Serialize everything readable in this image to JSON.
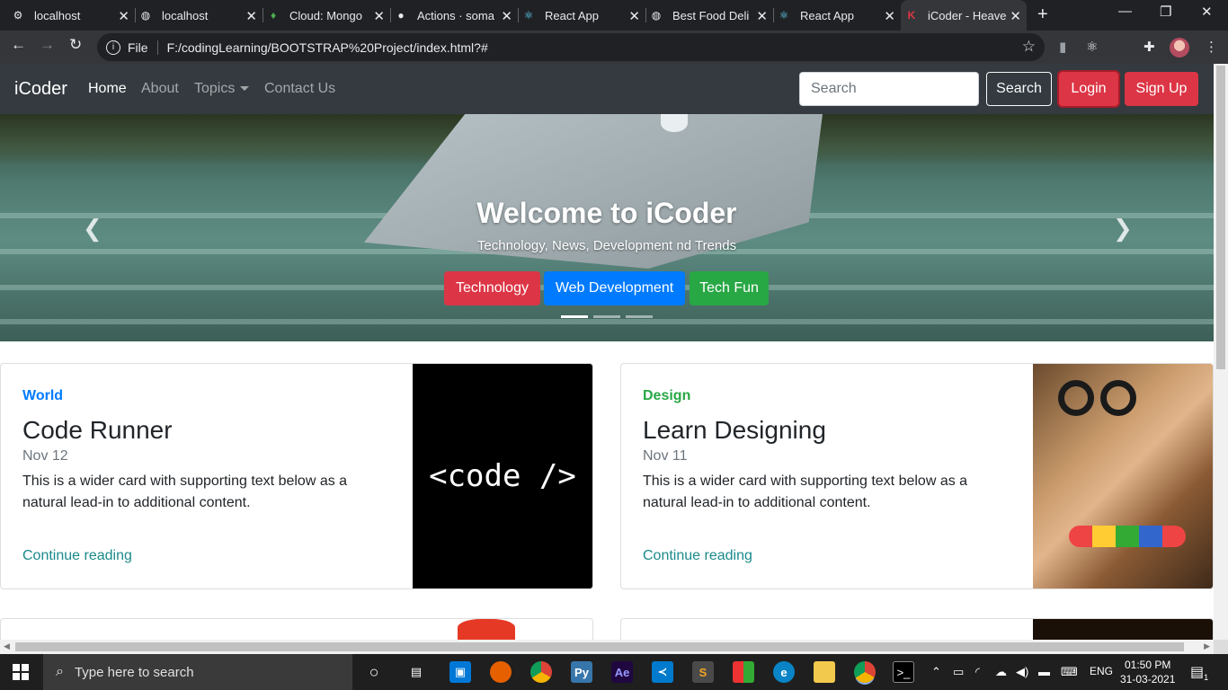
{
  "browser": {
    "tabs": [
      {
        "label": "localhost",
        "icon": "settings-icon",
        "x": 0
      },
      {
        "label": "localhost",
        "icon": "globe-icon"
      },
      {
        "label": "Cloud: Mongo",
        "icon": "leaf-icon"
      },
      {
        "label": "Actions · soma",
        "icon": "github-icon"
      },
      {
        "label": "React App",
        "icon": "react-icon"
      },
      {
        "label": "Best Food Deli",
        "icon": "globe-icon"
      },
      {
        "label": "React App",
        "icon": "react-icon"
      },
      {
        "label": "iCoder - Heave",
        "icon": "icoder-icon",
        "active": true
      }
    ],
    "file_label": "File",
    "url": "F:/codingLearning/BOOTSTRAP%20Project/index.html?#"
  },
  "navbar": {
    "brand": "iCoder",
    "links": [
      "Home",
      "About",
      "Topics",
      "Contact Us"
    ],
    "search_placeholder": "Search",
    "search_button": "Search",
    "login_button": "Login",
    "signup_button": "Sign Up"
  },
  "carousel": {
    "title": "Welcome to iCoder",
    "subtitle": "Technology, News, Development nd Trends",
    "buttons": [
      "Technology",
      "Web Development",
      "Tech Fun"
    ],
    "slide_count": 3,
    "active_slide": 1
  },
  "cards": [
    {
      "category": "World",
      "title": "Code Runner",
      "date": "Nov 12",
      "text": "This is a wider card with supporting text below as a natural lead-in to additional content.",
      "link": "Continue reading",
      "image_text": "<code />"
    },
    {
      "category": "Design",
      "title": "Learn Designing",
      "date": "Nov 11",
      "text": "This is a wider card with supporting text below as a natural lead-in to additional content.",
      "link": "Continue reading"
    }
  ],
  "taskbar": {
    "search_placeholder": "Type here to search",
    "language": "ENG",
    "time": "01:50 PM",
    "date": "31-03-2021",
    "notification_count": "1"
  },
  "colors": {
    "navbar_bg": "#343a40",
    "danger": "#dc3545",
    "primary": "#007bff",
    "success": "#28a745"
  }
}
